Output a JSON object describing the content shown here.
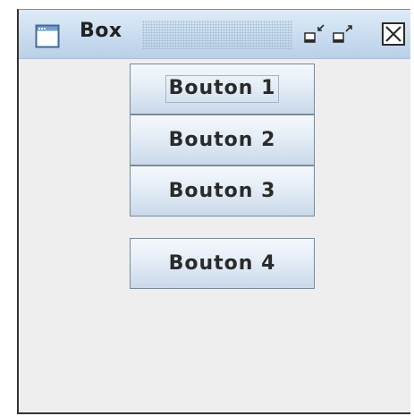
{
  "window": {
    "title": "Box"
  },
  "titlebar_buttons": {
    "iconify": "iconify-icon",
    "maximize": "maximize-icon",
    "close": "close-icon"
  },
  "buttons": [
    {
      "label": "Bouton 1",
      "focused": true
    },
    {
      "label": "Bouton 2",
      "focused": false
    },
    {
      "label": "Bouton 3",
      "focused": false
    },
    {
      "label": "Bouton 4",
      "focused": false
    }
  ],
  "colors": {
    "titlebar": "#c8dcef",
    "background": "#eeeeee",
    "button_border": "#7a8a99"
  }
}
